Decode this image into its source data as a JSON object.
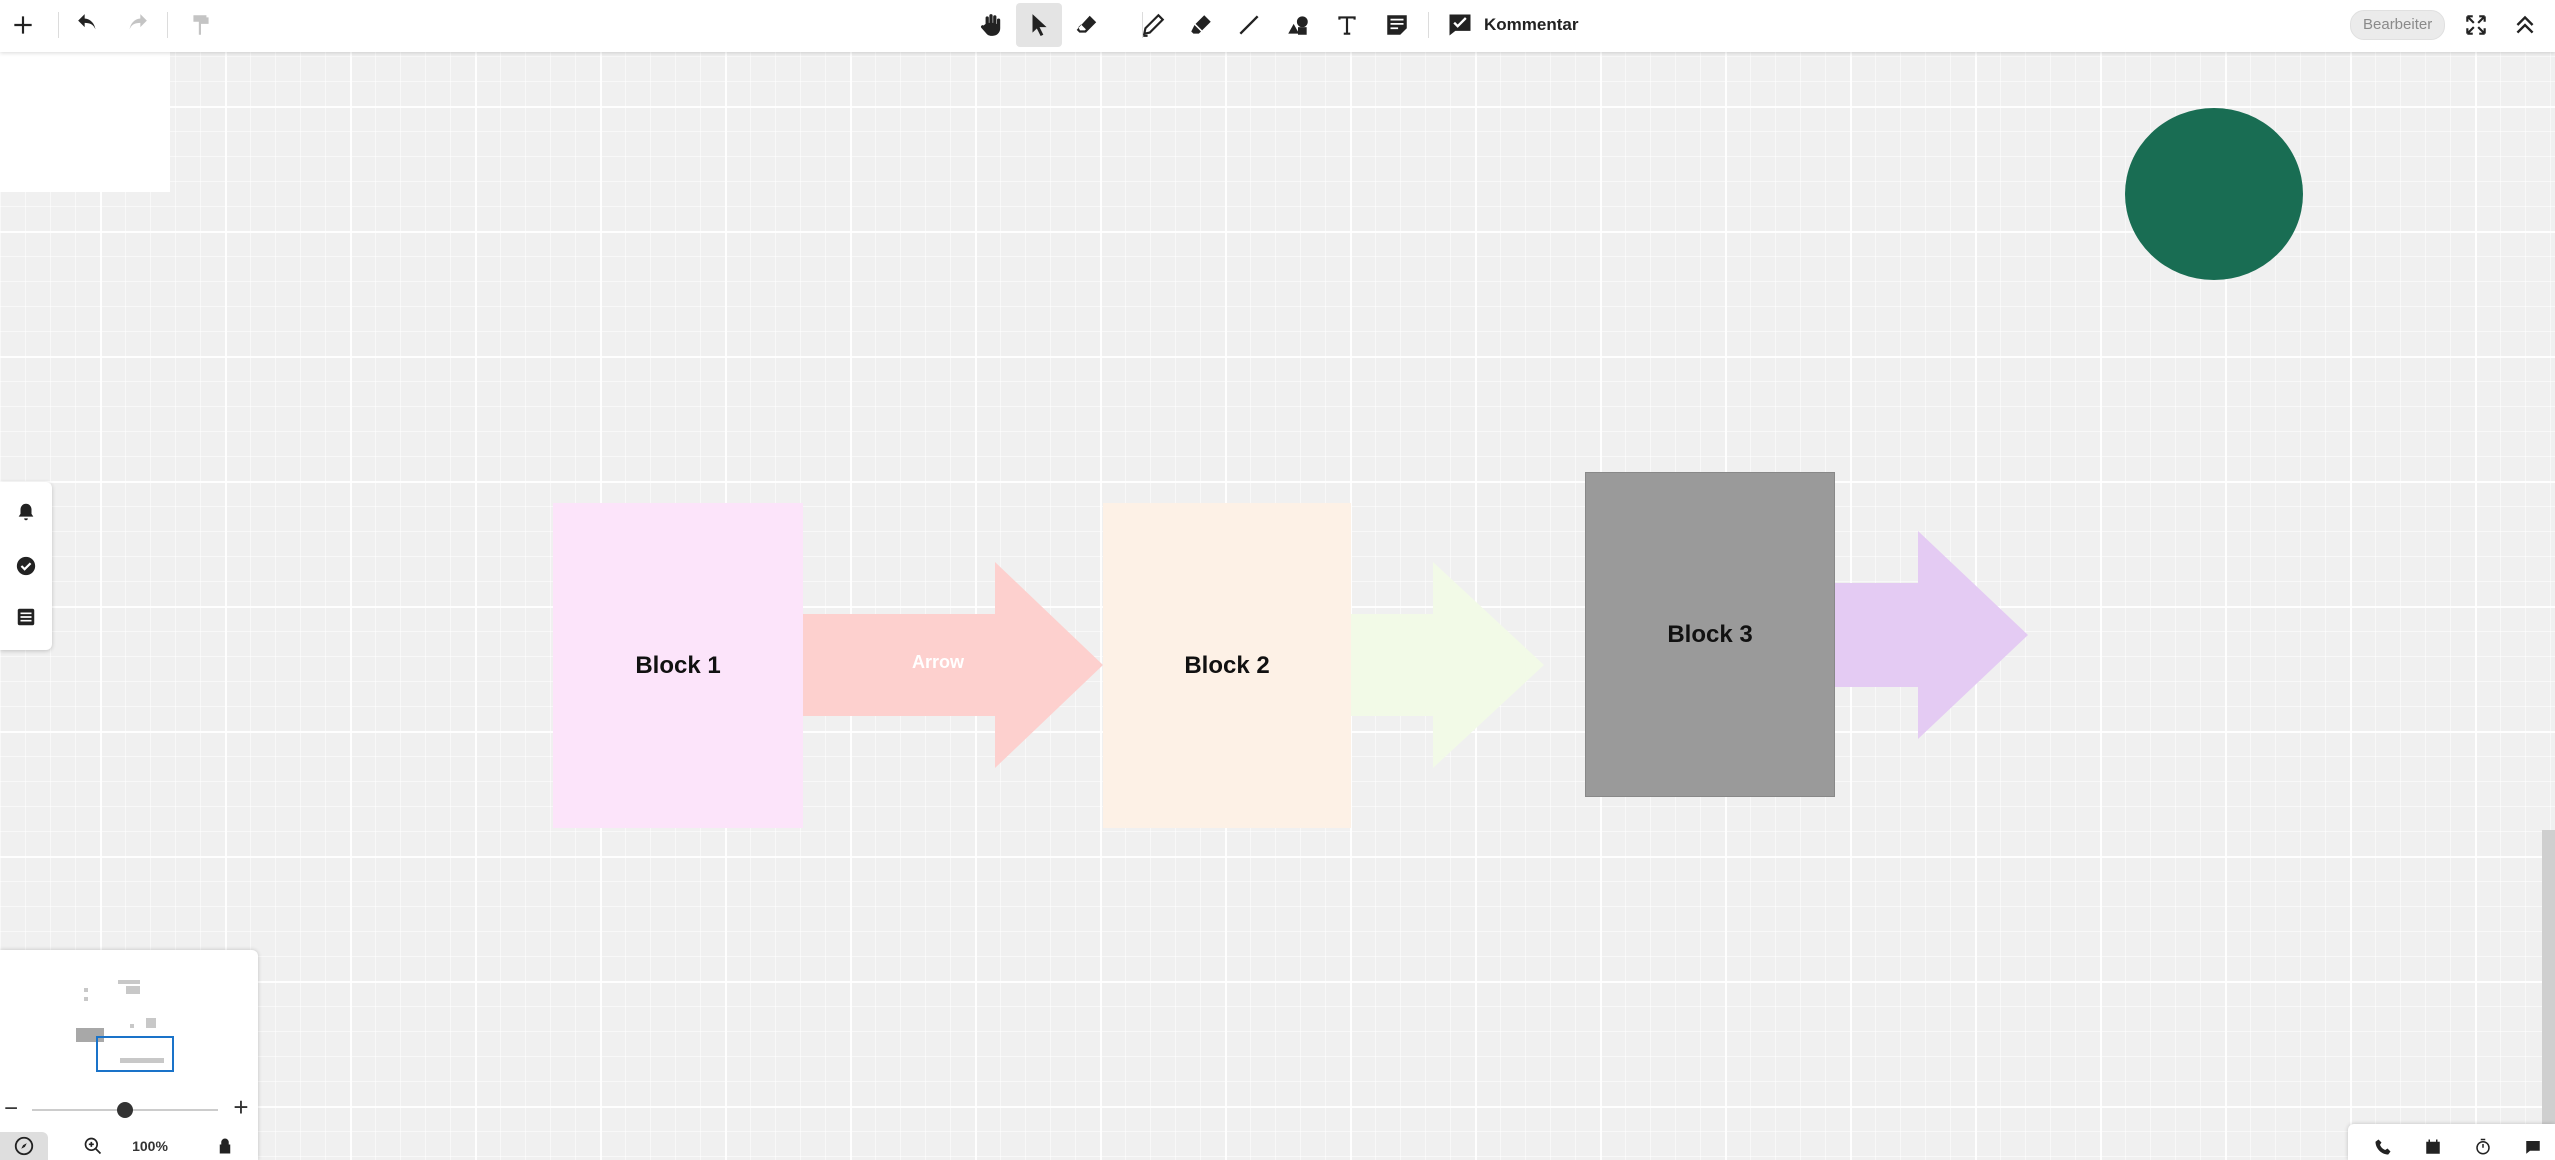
{
  "toolbar": {
    "comment_label": "Kommentar",
    "editor_badge": "Bearbeiter",
    "icons": [
      "plus-icon",
      "undo-icon",
      "redo-icon",
      "format-painter-icon",
      "hand-icon",
      "pointer-icon",
      "eraser-icon",
      "pen-icon",
      "marker-icon",
      "line-icon",
      "shapes-icon",
      "text-icon",
      "sticky-note-icon",
      "comment-icon",
      "fullscreen-icon",
      "collapse-icon"
    ]
  },
  "canvas": {
    "blocks": [
      {
        "label": "Block 1",
        "color": "#fce4fa"
      },
      {
        "label": "Block 2",
        "color": "#fdf1e6"
      },
      {
        "label": "Block 3",
        "color": "#9a9a9a"
      }
    ],
    "arrows": [
      {
        "label": "Arrow",
        "color": "#fdd0ce"
      },
      {
        "label": "",
        "color": "#f2fae7"
      },
      {
        "label": "",
        "color": "#e4cbf3"
      }
    ],
    "circle_color": "#196d53"
  },
  "left_panel": {
    "icons": [
      "bell-icon",
      "check-circle-icon",
      "list-icon"
    ]
  },
  "minimap": {
    "zoom_label": "100%",
    "zoom_minus": "−",
    "zoom_plus": "+",
    "frame_color": "#1a73c9"
  },
  "bottom_right": {
    "icons": [
      "phone-icon",
      "calendar-icon",
      "timer-icon",
      "chat-icon"
    ]
  }
}
